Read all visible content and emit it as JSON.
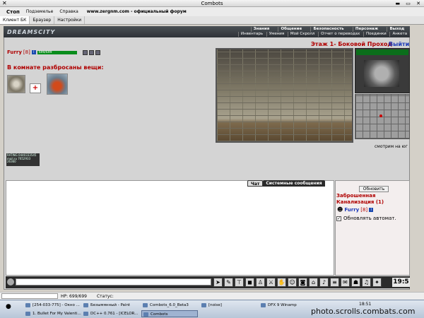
{
  "window": {
    "title": "Combots",
    "close_icon": "close-icon",
    "controls": "▬ ▭ ✕"
  },
  "menu": {
    "stop": "Стоп",
    "items": [
      "Подземелье",
      "Справка"
    ],
    "url": "www.zergnm.com - официальный форум"
  },
  "tabs": [
    "Клиент БК",
    "Браузер",
    "Настройки"
  ],
  "header": {
    "logo": "DREAMSCITY",
    "nav_top": [
      "Знания",
      "Общение",
      "Безопасность",
      "Персонаж",
      "Выход"
    ],
    "nav_bottom": [
      "Инвентарь",
      "Умения",
      "Мой Скролл",
      "Отчет о переводах",
      "Поединки",
      "Анкета"
    ]
  },
  "player": {
    "name": "Furry",
    "level": "[8]",
    "info": "i",
    "hp_label": "699/699",
    "hp_fraction": 1.0
  },
  "room": {
    "items_title": "В комнате разбросаны вещи:"
  },
  "counters": {
    "line1": "RATING 0440333545",
    "line2": "mail.ru 7652933",
    "line3": "26360"
  },
  "location": {
    "title": "Этаж 1- Боковой Проход",
    "exit": "Выйти",
    "looking": "смотрим на юг"
  },
  "chat": {
    "tabs": [
      "Чат",
      "Системные сообщения"
    ]
  },
  "side": {
    "refresh": "Обновить",
    "zone": "Заброшенная Канализация (1)",
    "user_name": "Furry",
    "user_level": "[8]",
    "user_info": "i",
    "auto_update": "Обновлять автомат."
  },
  "bottom": {
    "clock": "19:5",
    "hp_status": "HP: 699/699",
    "status_label": "Статус:"
  },
  "taskbar": {
    "row1": [
      "[254-033-775] - Окно ...",
      "Безымянный - Paint",
      "Combots_6.0_Beta3",
      "[noise]",
      "DFX 9 Winamp"
    ],
    "row2": [
      "1. Bullet For My Valenti...",
      "DC++ 0.761 - [ICELOR...",
      "Combots"
    ],
    "time": "18:51"
  },
  "watermark": "photo.scrolls.combats.com"
}
